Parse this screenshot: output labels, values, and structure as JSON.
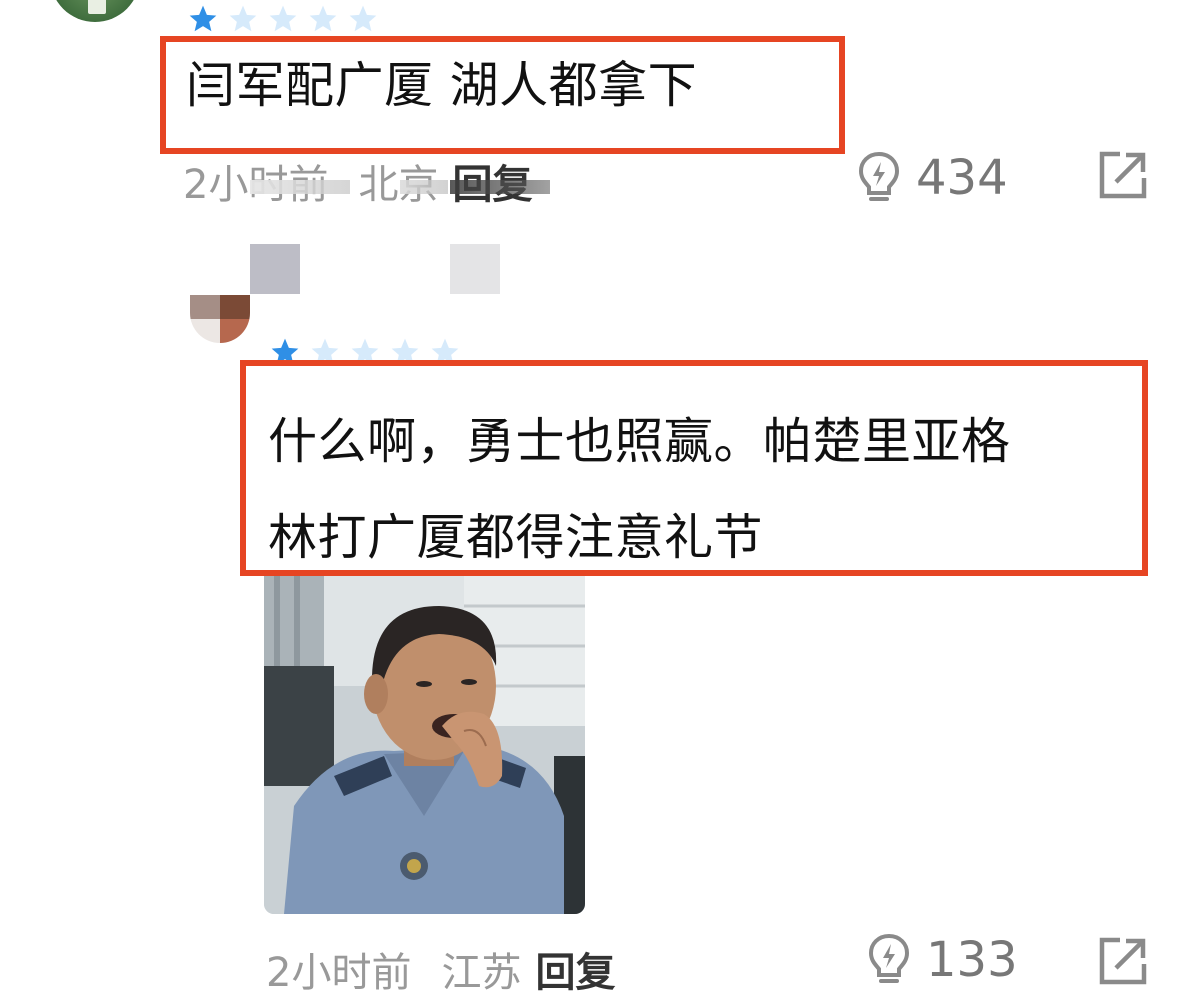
{
  "comments": [
    {
      "rating": 1,
      "max_rating": 5,
      "text": "闫军配广厦 湖人都拿下",
      "time": "2小时前",
      "location": "北京",
      "reply_label": "回复",
      "likes": "434"
    },
    {
      "rating": 1,
      "max_rating": 5,
      "text_lines": [
        "什么啊，勇士也照赢。帕楚里亚格",
        "林打广厦都得注意礼节"
      ],
      "time": "2小时前",
      "location": "江苏",
      "reply_label": "回复",
      "likes": "133"
    }
  ],
  "colors": {
    "highlight_border": "#e64523",
    "star_filled": "#2f8fe6",
    "star_empty": "#d6eafb",
    "meta_text": "#999999",
    "reply_text": "#333333"
  },
  "icons": {
    "like": "lightbulb-icon",
    "share": "share-arrow-icon",
    "star": "star-icon"
  }
}
